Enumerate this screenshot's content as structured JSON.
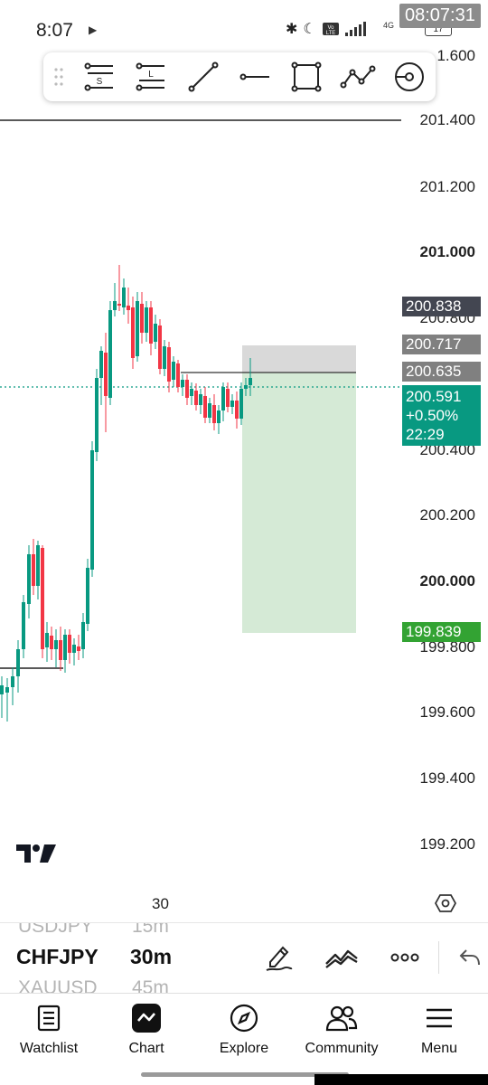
{
  "status": {
    "time": "8:07",
    "clock_overlay": "08:07:31",
    "network": "4G",
    "battery": "17"
  },
  "toolbar": {
    "tools": [
      "grip-handle",
      "long-position-tool",
      "short-position-tool",
      "trend-line-tool",
      "horizontal-ray-tool",
      "rectangle-tool",
      "path-tool",
      "brush-tool"
    ]
  },
  "chart": {
    "price_axis": [
      "1.600",
      "201.400",
      "201.200",
      "201.000",
      "200.800",
      "200.400",
      "200.200",
      "200.000",
      "199.800",
      "199.600",
      "199.400",
      "199.200"
    ],
    "tags": {
      "high_marker": "200.838",
      "stop_loss": "200.717",
      "entry": "200.635",
      "last_price": "200.591",
      "change": "+0.50%",
      "countdown": "22:29",
      "take_profit": "199.839"
    },
    "time_label": "30",
    "colors": {
      "up": "#089981",
      "down": "#f23645",
      "profit_zone": "#d5ead6",
      "stop_zone": "#d9d9d9"
    }
  },
  "symbol_bar": {
    "prev_symbol": "USDJPY",
    "prev_interval": "15m",
    "symbol": "CHFJPY",
    "interval": "30m",
    "next_symbol": "XAUUSD",
    "next_interval": "45m"
  },
  "nav": {
    "watchlist": "Watchlist",
    "chart": "Chart",
    "explore": "Explore",
    "community": "Community",
    "menu": "Menu"
  }
}
